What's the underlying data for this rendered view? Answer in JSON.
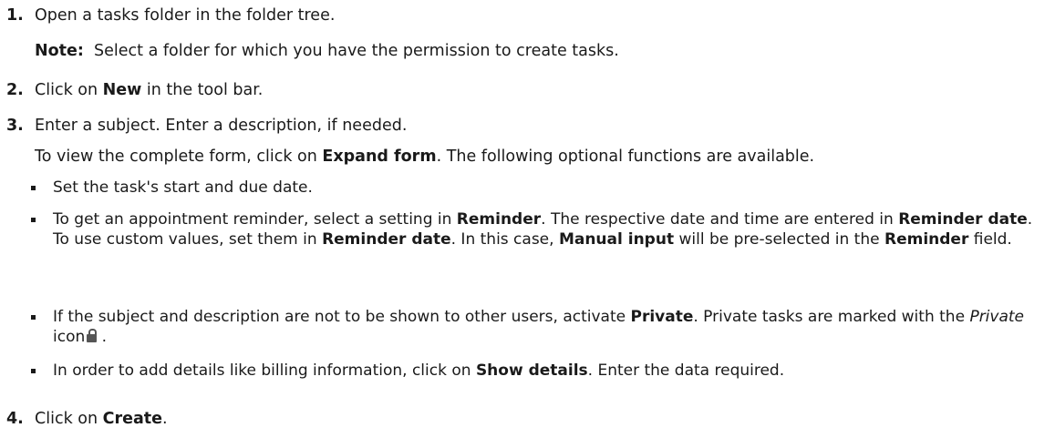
{
  "steps": [
    {
      "number": "1.",
      "text": "Open a tasks folder in the folder tree.",
      "note_label": "Note:",
      "note_text": "Select a folder for which you have the permission to create tasks."
    },
    {
      "number": "2.",
      "pre": "Click on ",
      "bold": "New",
      "post": " in the tool bar."
    },
    {
      "number": "3.",
      "text": "Enter a subject. Enter a description, if needed.",
      "line2_pre": "To view the complete form, click on ",
      "line2_bold": "Expand form",
      "line2_post": ". The following optional functions are available.",
      "bullets": [
        {
          "text": "Set the task's start and due date."
        },
        {
          "p1": "To get an appointment reminder, select a setting in ",
          "b1": "Reminder",
          "p2": ". The respective date and time are entered in ",
          "b2": "Reminder date",
          "p3": ".",
          "p4": "To use custom values, set them in ",
          "b3": "Reminder date",
          "p5": ". In this case, ",
          "b4": "Manual input",
          "p6": " will be pre-selected in the ",
          "b5": "Reminder",
          "p7": " field."
        },
        {
          "p1": "If the subject and description are not to be shown to other users, activate ",
          "b1": "Private",
          "p2": ". Private tasks are marked with the ",
          "i1": "Private",
          "p3": " icon",
          "p4": " ."
        },
        {
          "p1": "In order to add details like billing information, click on ",
          "b1": "Show details",
          "p2": ". Enter the data required."
        }
      ]
    },
    {
      "number": "4.",
      "pre": "Click on ",
      "bold": "Create",
      "post": "."
    }
  ]
}
